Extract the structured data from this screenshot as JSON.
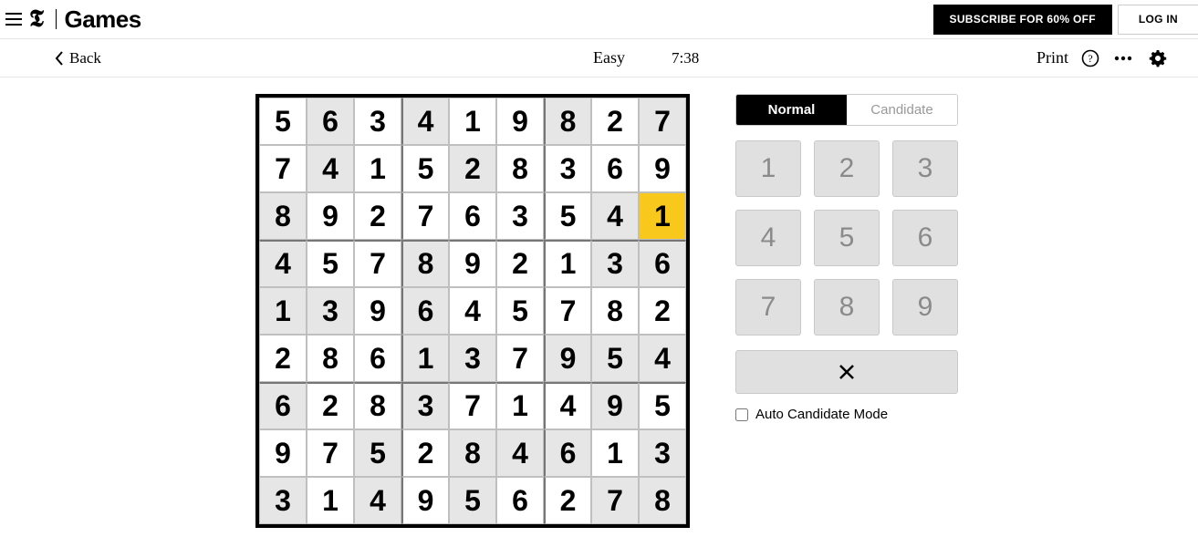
{
  "header": {
    "brand_games": "Games",
    "subscribe": "SUBSCRIBE FOR 60% OFF",
    "login": "LOG IN"
  },
  "toolbar": {
    "back": "Back",
    "difficulty": "Easy",
    "timer": "7:38",
    "print": "Print"
  },
  "mode": {
    "normal": "Normal",
    "candidate": "Candidate"
  },
  "keypad": [
    "1",
    "2",
    "3",
    "4",
    "5",
    "6",
    "7",
    "8",
    "9"
  ],
  "auto_label": "Auto Candidate Mode",
  "board": {
    "selected": [
      2,
      8
    ],
    "gray_pattern": [
      [
        0,
        1,
        0,
        1,
        0,
        0,
        1,
        0,
        1
      ],
      [
        0,
        1,
        0,
        0,
        1,
        0,
        0,
        0,
        0
      ],
      [
        1,
        0,
        0,
        0,
        0,
        0,
        0,
        1,
        0
      ],
      [
        1,
        0,
        0,
        1,
        0,
        0,
        0,
        1,
        1
      ],
      [
        1,
        1,
        0,
        1,
        0,
        0,
        0,
        0,
        0
      ],
      [
        0,
        0,
        0,
        1,
        1,
        0,
        1,
        1,
        1
      ],
      [
        1,
        0,
        0,
        1,
        0,
        0,
        0,
        1,
        0
      ],
      [
        0,
        0,
        1,
        0,
        1,
        1,
        1,
        0,
        1
      ],
      [
        1,
        0,
        1,
        0,
        1,
        0,
        0,
        1,
        1
      ]
    ],
    "cells": [
      [
        "5",
        "6",
        "3",
        "4",
        "1",
        "9",
        "8",
        "2",
        "7"
      ],
      [
        "7",
        "4",
        "1",
        "5",
        "2",
        "8",
        "3",
        "6",
        "9"
      ],
      [
        "8",
        "9",
        "2",
        "7",
        "6",
        "3",
        "5",
        "4",
        "1"
      ],
      [
        "4",
        "5",
        "7",
        "8",
        "9",
        "2",
        "1",
        "3",
        "6"
      ],
      [
        "1",
        "3",
        "9",
        "6",
        "4",
        "5",
        "7",
        "8",
        "2"
      ],
      [
        "2",
        "8",
        "6",
        "1",
        "3",
        "7",
        "9",
        "5",
        "4"
      ],
      [
        "6",
        "2",
        "8",
        "3",
        "7",
        "1",
        "4",
        "9",
        "5"
      ],
      [
        "9",
        "7",
        "5",
        "2",
        "8",
        "4",
        "6",
        "1",
        "3"
      ],
      [
        "3",
        "1",
        "4",
        "9",
        "5",
        "6",
        "2",
        "7",
        "8"
      ]
    ]
  }
}
